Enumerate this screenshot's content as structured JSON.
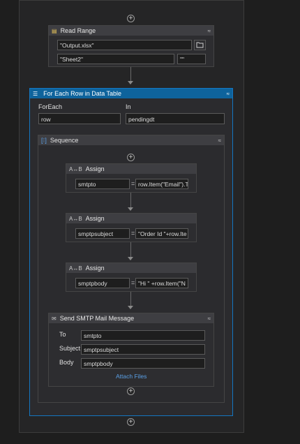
{
  "read_range": {
    "title": "Read Range",
    "workbook_path": "\"Output.xlsx\"",
    "sheet_name": "\"Sheet2\"",
    "range": "\"\""
  },
  "for_each": {
    "title": "For Each Row in Data Table",
    "foreach_label": "ForEach",
    "in_label": "In",
    "item_value": "row",
    "table_value": "pendingdt"
  },
  "sequence": {
    "title": "Sequence"
  },
  "assigns": [
    {
      "title": "Assign",
      "to": "smtpto",
      "value": "row.Item(\"Email\").T"
    },
    {
      "title": "Assign",
      "to": "smptpsubject",
      "value": "\"Order Id \"+row.Ite"
    },
    {
      "title": "Assign",
      "to": "smptpbody",
      "value": "\"Hi \" +row.Item(\"N"
    }
  ],
  "assign_equals": "=",
  "smtp": {
    "title": "Send SMTP Mail Message",
    "to_label": "To",
    "to_value": "smtpto",
    "subject_label": "Subject",
    "subject_value": "smptpsubject",
    "body_label": "Body",
    "body_value": "smptpbody",
    "attach_label": "Attach Files"
  },
  "icons": {
    "add": "+",
    "collapse": "≈",
    "folder": "folder-icon",
    "assign": "assign-icon",
    "read_range": "excel-icon",
    "for_each": "for-each-icon",
    "sequence": "sequence-icon",
    "smtp": "mail-icon"
  },
  "colors": {
    "canvas": "#1e1e1e",
    "activity_header": "#3e3e42",
    "for_each_header": "#0e639c",
    "link": "#5aa0e6"
  }
}
